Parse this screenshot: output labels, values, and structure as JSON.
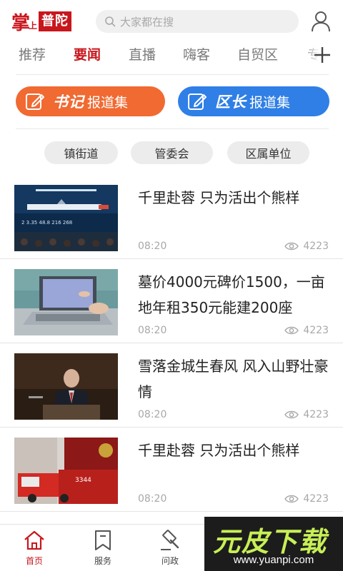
{
  "header": {
    "logo_part1": "掌",
    "logo_part2": "上",
    "logo_part3": "普陀",
    "search_placeholder": "大家都在搜"
  },
  "tabs": [
    {
      "label": "推荐",
      "active": false
    },
    {
      "label": "要闻",
      "active": true
    },
    {
      "label": "直播",
      "active": false
    },
    {
      "label": "嗨客",
      "active": false
    },
    {
      "label": "自贸区",
      "active": false
    },
    {
      "label": "专",
      "active": false
    }
  ],
  "report_buttons": [
    {
      "calligraphy": "书记",
      "label": "报道集",
      "color": "#f06a32"
    },
    {
      "calligraphy": "区长",
      "label": "报道集",
      "color": "#2f7fe6"
    }
  ],
  "pills": [
    "镇街道",
    "管委会",
    "区属单位"
  ],
  "news": [
    {
      "title": "千里赴蓉 只为活出个熊样",
      "time": "08:20",
      "views": "4223",
      "thumb": "stage-presentation"
    },
    {
      "title": "墓价4000元碑价1500，一亩地年租350元能建200座",
      "time": "08:20",
      "views": "4223",
      "thumb": "laptop-typing"
    },
    {
      "title": "雪落金城生春风  风入山野壮豪情",
      "time": "08:20",
      "views": "4223",
      "thumb": "speaker-podium"
    },
    {
      "title": "千里赴蓉 只为活出个熊样",
      "time": "08:20",
      "views": "4223",
      "thumb": "fire-truck"
    }
  ],
  "bottom_nav": [
    {
      "label": "首页",
      "icon": "home-icon",
      "active": true
    },
    {
      "label": "服务",
      "icon": "bookmark-icon",
      "active": false
    },
    {
      "label": "问政",
      "icon": "gavel-icon",
      "active": false
    }
  ],
  "watermark": {
    "main": "元皮下载",
    "url": "www.yuanpi.com"
  },
  "colors": {
    "brand_red": "#c8161d",
    "orange": "#f06a32",
    "blue": "#2f7fe6",
    "watermark_green": "#c7ef56"
  }
}
